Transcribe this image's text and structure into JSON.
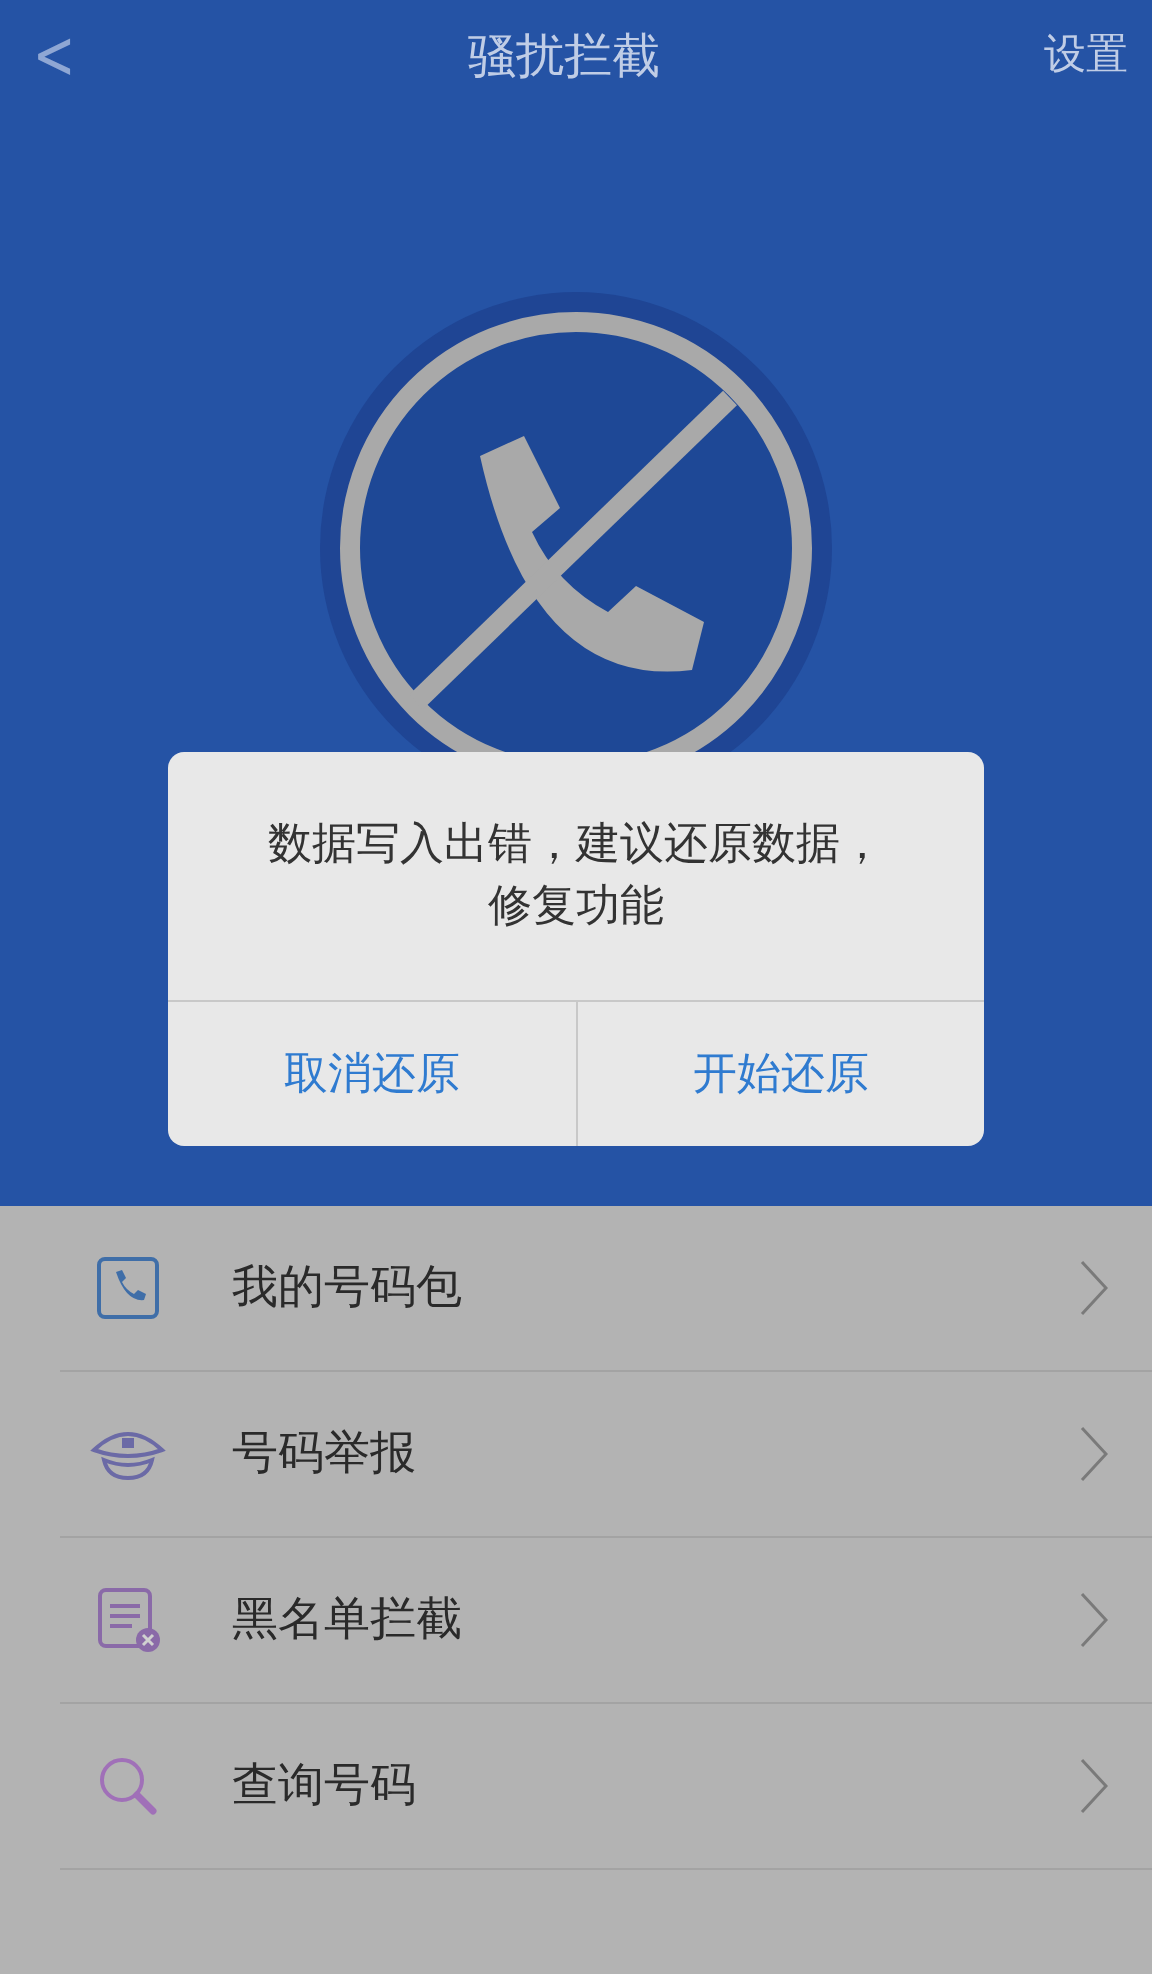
{
  "header": {
    "back": "<",
    "title": "骚扰拦截",
    "settings": "设置"
  },
  "dialog": {
    "message": "数据写入出错，建议还原数据，修复功能",
    "buttons": [
      "取消还原",
      "开始还原"
    ]
  },
  "menu": [
    {
      "kind": "phone",
      "label": "我的号码包"
    },
    {
      "kind": "cap",
      "label": "号码举报"
    },
    {
      "kind": "list",
      "label": "黑名单拦截"
    },
    {
      "kind": "search",
      "label": "查询号码"
    }
  ]
}
